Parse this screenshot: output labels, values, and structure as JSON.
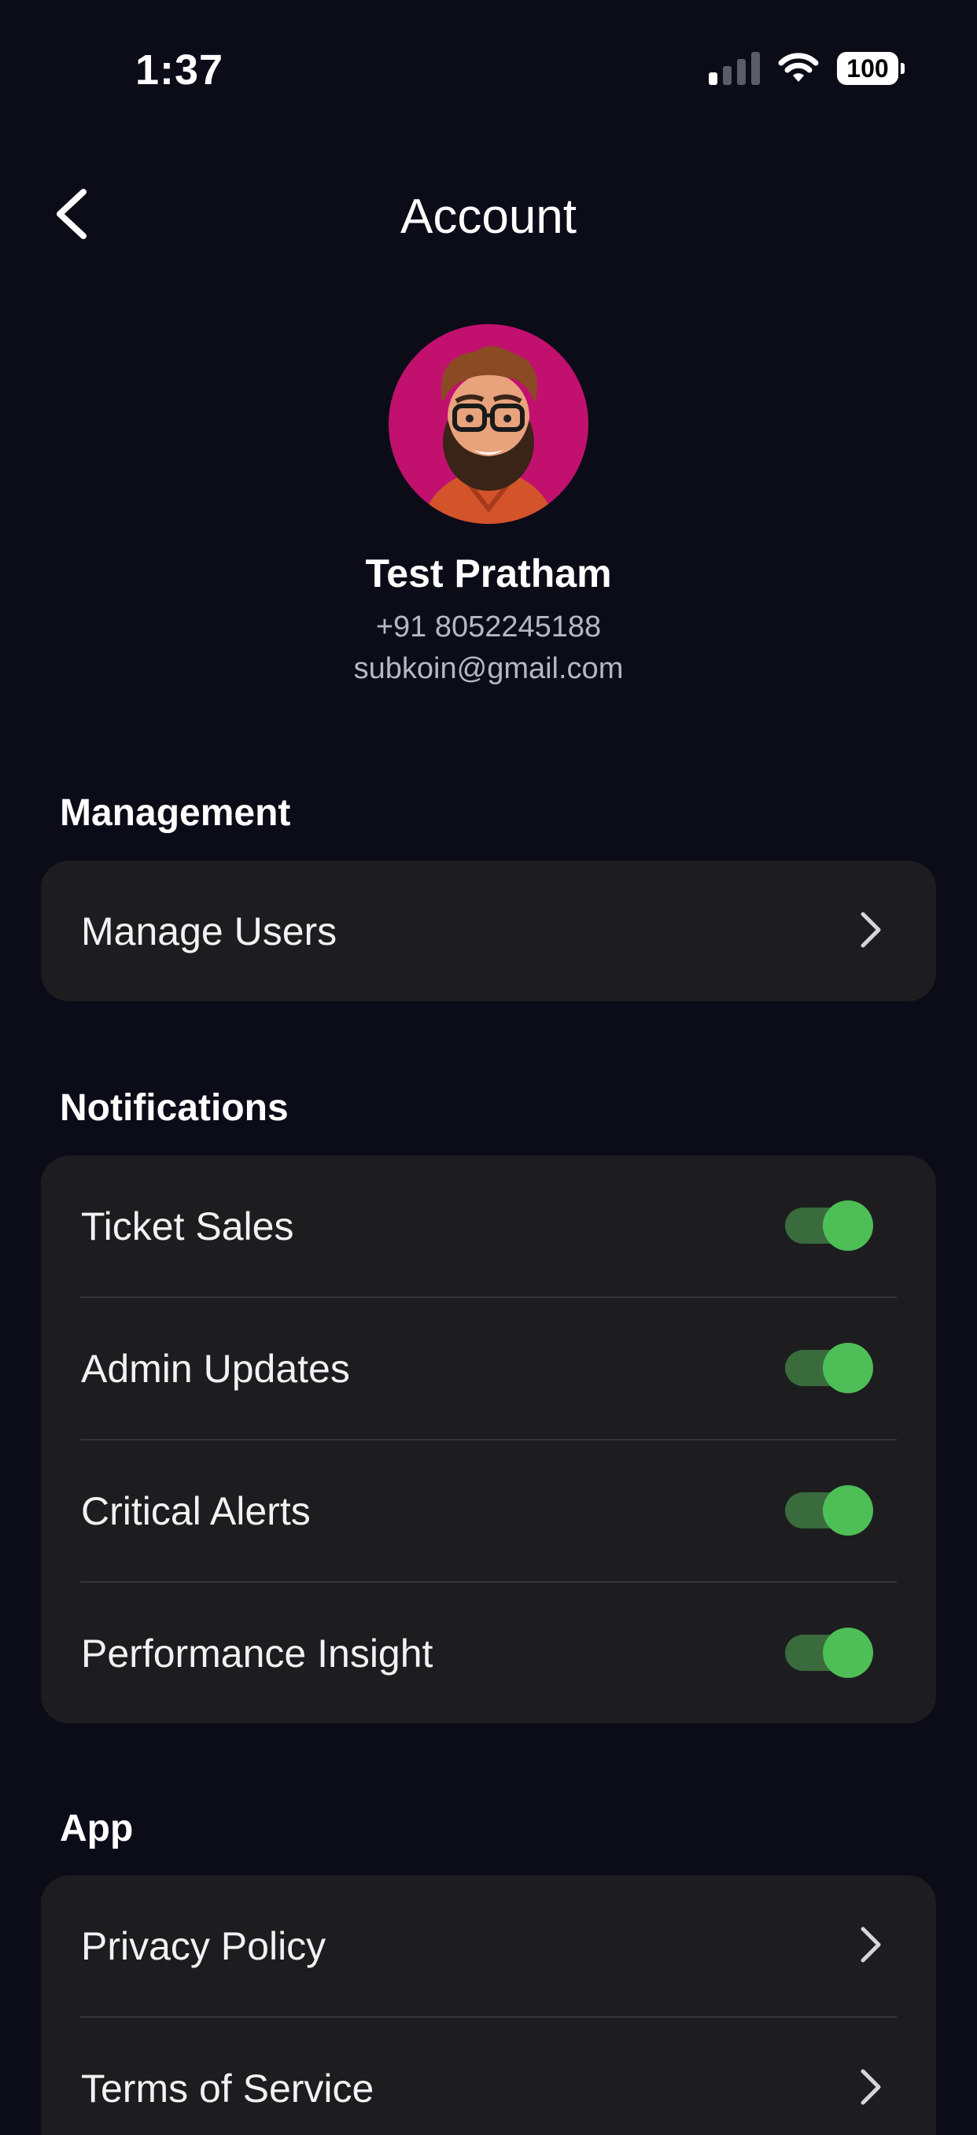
{
  "status_bar": {
    "time": "1:37",
    "signal_icon": "cellular-signal-icon",
    "wifi_icon": "wifi-icon",
    "battery_level": "100",
    "signal_bars_active": 1,
    "signal_bars_total": 4
  },
  "nav": {
    "title": "Account",
    "back_icon": "chevron-left-icon"
  },
  "profile": {
    "name": "Test Pratham",
    "phone": "+91 8052245188",
    "email": "subkoin@gmail.com",
    "avatar_icon": "avatar-cartoon-bearded-man",
    "avatar_background": "#c2106f"
  },
  "sections": {
    "management": {
      "heading": "Management",
      "items": [
        {
          "label": "Manage Users"
        }
      ]
    },
    "notifications": {
      "heading": "Notifications",
      "items": [
        {
          "label": "Ticket Sales",
          "enabled": true
        },
        {
          "label": "Admin Updates",
          "enabled": true
        },
        {
          "label": "Critical Alerts",
          "enabled": true
        },
        {
          "label": "Performance Insight",
          "enabled": true
        }
      ]
    },
    "app": {
      "heading": "App",
      "items": [
        {
          "label": "Privacy Policy"
        },
        {
          "label": "Terms of Service"
        }
      ]
    }
  },
  "colors": {
    "background": "#0b0c17",
    "card": "#1d1d1f",
    "toggle_on_knob": "#4ebe57",
    "toggle_on_track": "#3a6b3d"
  }
}
